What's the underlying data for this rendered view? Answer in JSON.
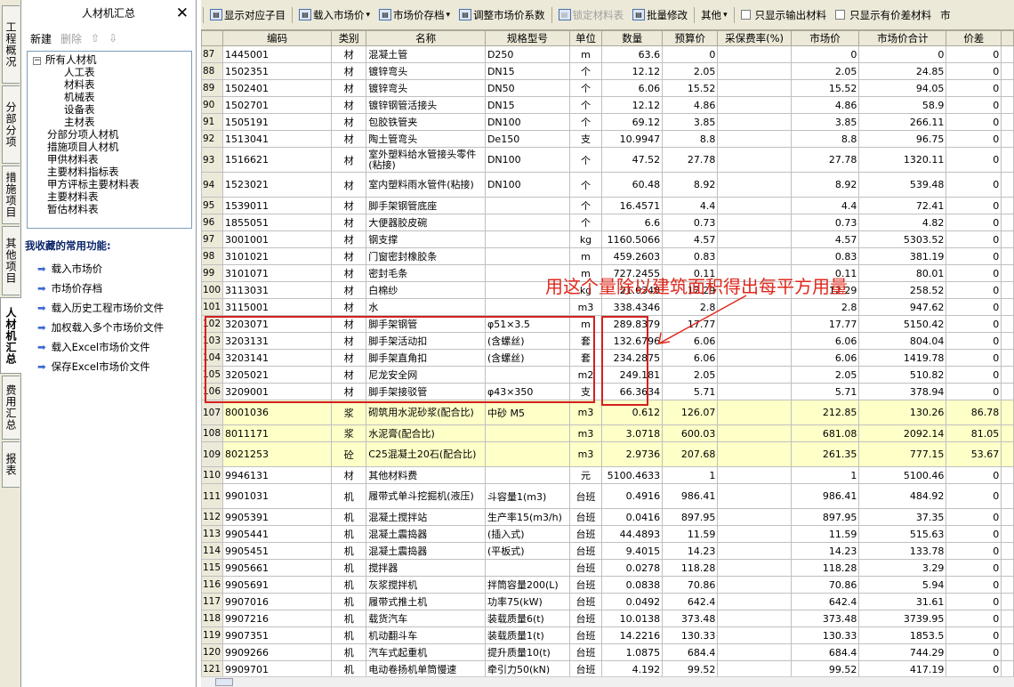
{
  "sidetabs": [
    {
      "label": "工程概况",
      "active": false
    },
    {
      "label": "分部分项",
      "active": false
    },
    {
      "label": "措施项目",
      "active": false
    },
    {
      "label": "其他项目",
      "active": false
    },
    {
      "label": "人材机汇总",
      "active": true
    },
    {
      "label": "费用汇总",
      "active": false
    },
    {
      "label": "报表",
      "active": false
    }
  ],
  "left": {
    "title": "人材机汇总",
    "close": "✕",
    "new": "新建",
    "delete": "删除",
    "tree": {
      "root": "所有人材机",
      "children": [
        "人工表",
        "材料表",
        "机械表",
        "设备表",
        "主材表"
      ],
      "others": [
        "分部分项人材机",
        "措施项目人材机",
        "甲供材料表",
        "主要材料指标表",
        "甲方评标主要材料表",
        "主要材料表",
        "暂估材料表"
      ]
    },
    "fav_title": "我收藏的常用功能:",
    "favs": [
      "载入市场价",
      "市场价存档",
      "载入历史工程市场价文件",
      "加权载入多个市场价文件",
      "载入Excel市场价文件",
      "保存Excel市场价文件"
    ]
  },
  "toolbar": [
    {
      "label": "显示对应子目",
      "icon": "list-icon",
      "disabled": false,
      "dropdown": false
    },
    {
      "label": "载入市场价",
      "icon": "load-price-icon",
      "disabled": false,
      "dropdown": true
    },
    {
      "label": "市场价存档",
      "icon": "archive-icon",
      "disabled": false,
      "dropdown": true
    },
    {
      "label": "调整市场价系数",
      "icon": "adjust-icon",
      "disabled": false,
      "dropdown": false
    },
    {
      "label": "锁定材料表",
      "icon": "lock-icon",
      "disabled": true,
      "dropdown": false
    },
    {
      "label": "批量修改",
      "icon": "batch-edit-icon",
      "disabled": false,
      "dropdown": false
    },
    {
      "label": "其他",
      "icon": "",
      "disabled": false,
      "dropdown": true
    },
    {
      "label": "只显示输出材料",
      "icon": "",
      "checkbox": true
    },
    {
      "label": "只显示有价差材料",
      "icon": "",
      "checkbox": true
    },
    {
      "label": "市",
      "icon": "",
      "disabled": false,
      "dropdown": false
    }
  ],
  "columns": [
    "",
    "编码",
    "类别",
    "名称",
    "规格型号",
    "单位",
    "数量",
    "预算价",
    "采保费率(%)",
    "市场价",
    "市场价合计",
    "价差",
    ""
  ],
  "rows": [
    {
      "no": "87",
      "code": "1445001",
      "cat": "材",
      "name": "混凝土管",
      "spec": "D250",
      "unit": "m",
      "qty": "63.6",
      "budget": "0",
      "rate": "",
      "market": "0",
      "total": "0",
      "diff": "0"
    },
    {
      "no": "88",
      "code": "1502351",
      "cat": "材",
      "name": "镀锌弯头",
      "spec": "DN15",
      "unit": "个",
      "qty": "12.12",
      "budget": "2.05",
      "rate": "",
      "market": "2.05",
      "total": "24.85",
      "diff": "0"
    },
    {
      "no": "89",
      "code": "1502401",
      "cat": "材",
      "name": "镀锌弯头",
      "spec": "DN50",
      "unit": "个",
      "qty": "6.06",
      "budget": "15.52",
      "rate": "",
      "market": "15.52",
      "total": "94.05",
      "diff": "0"
    },
    {
      "no": "90",
      "code": "1502701",
      "cat": "材",
      "name": "镀锌钢管活接头",
      "spec": "DN15",
      "unit": "个",
      "qty": "12.12",
      "budget": "4.86",
      "rate": "",
      "market": "4.86",
      "total": "58.9",
      "diff": "0"
    },
    {
      "no": "91",
      "code": "1505191",
      "cat": "材",
      "name": "包胶铁管夹",
      "spec": "DN100",
      "unit": "个",
      "qty": "69.12",
      "budget": "3.85",
      "rate": "",
      "market": "3.85",
      "total": "266.11",
      "diff": "0"
    },
    {
      "no": "92",
      "code": "1513041",
      "cat": "材",
      "name": "陶土管弯头",
      "spec": "De150",
      "unit": "支",
      "qty": "10.9947",
      "budget": "8.8",
      "rate": "",
      "market": "8.8",
      "total": "96.75",
      "diff": "0"
    },
    {
      "no": "93",
      "code": "1516621",
      "cat": "材",
      "name": "室外塑料给水管接头零件(粘接)",
      "spec": "DN100",
      "unit": "个",
      "qty": "47.52",
      "budget": "27.78",
      "rate": "",
      "market": "27.78",
      "total": "1320.11",
      "diff": "0",
      "tall": true
    },
    {
      "no": "94",
      "code": "1523021",
      "cat": "材",
      "name": "室内塑料雨水管件(粘接)",
      "spec": "DN100",
      "unit": "个",
      "qty": "60.48",
      "budget": "8.92",
      "rate": "",
      "market": "8.92",
      "total": "539.48",
      "diff": "0",
      "tall": true
    },
    {
      "no": "95",
      "code": "1539011",
      "cat": "材",
      "name": "脚手架钢管底座",
      "spec": "",
      "unit": "个",
      "qty": "16.4571",
      "budget": "4.4",
      "rate": "",
      "market": "4.4",
      "total": "72.41",
      "diff": "0"
    },
    {
      "no": "96",
      "code": "1855051",
      "cat": "材",
      "name": "大便器胶皮碗",
      "spec": "",
      "unit": "个",
      "qty": "6.6",
      "budget": "0.73",
      "rate": "",
      "market": "0.73",
      "total": "4.82",
      "diff": "0"
    },
    {
      "no": "97",
      "code": "3001001",
      "cat": "材",
      "name": "钢支撑",
      "spec": "",
      "unit": "kg",
      "qty": "1160.5066",
      "budget": "4.57",
      "rate": "",
      "market": "4.57",
      "total": "5303.52",
      "diff": "0"
    },
    {
      "no": "98",
      "code": "3101021",
      "cat": "材",
      "name": "门窗密封橡胶条",
      "spec": "",
      "unit": "m",
      "qty": "459.2603",
      "budget": "0.83",
      "rate": "",
      "market": "0.83",
      "total": "381.19",
      "diff": "0"
    },
    {
      "no": "99",
      "code": "3101071",
      "cat": "材",
      "name": "密封毛条",
      "spec": "",
      "unit": "m",
      "qty": "727.2455",
      "budget": "0.11",
      "rate": "",
      "market": "0.11",
      "total": "80.01",
      "diff": "0"
    },
    {
      "no": "100",
      "code": "3113031",
      "cat": "材",
      "name": "白棉纱",
      "spec": "",
      "unit": "kg",
      "qty": "21.0348",
      "budget": "12.29",
      "rate": "",
      "market": "12.29",
      "total": "258.52",
      "diff": "0"
    },
    {
      "no": "101",
      "code": "3115001",
      "cat": "材",
      "name": "水",
      "spec": "",
      "unit": "m3",
      "qty": "338.4346",
      "budget": "2.8",
      "rate": "",
      "market": "2.8",
      "total": "947.62",
      "diff": "0"
    },
    {
      "no": "102",
      "code": "3203071",
      "cat": "材",
      "name": "脚手架钢管",
      "spec": "φ51×3.5",
      "unit": "m",
      "qty": "289.8379",
      "budget": "17.77",
      "rate": "",
      "market": "17.77",
      "total": "5150.42",
      "diff": "0"
    },
    {
      "no": "103",
      "code": "3203131",
      "cat": "材",
      "name": "脚手架活动扣",
      "spec": "(含螺丝)",
      "unit": "套",
      "qty": "132.6796",
      "budget": "6.06",
      "rate": "",
      "market": "6.06",
      "total": "804.04",
      "diff": "0"
    },
    {
      "no": "104",
      "code": "3203141",
      "cat": "材",
      "name": "脚手架直角扣",
      "spec": "(含螺丝)",
      "unit": "套",
      "qty": "234.2875",
      "budget": "6.06",
      "rate": "",
      "market": "6.06",
      "total": "1419.78",
      "diff": "0"
    },
    {
      "no": "105",
      "code": "3205021",
      "cat": "材",
      "name": "尼龙安全网",
      "spec": "",
      "unit": "m2",
      "qty": "249.181",
      "budget": "2.05",
      "rate": "",
      "market": "2.05",
      "total": "510.82",
      "diff": "0"
    },
    {
      "no": "106",
      "code": "3209001",
      "cat": "材",
      "name": "脚手架接驳管",
      "spec": "φ43×350",
      "unit": "支",
      "qty": "66.3634",
      "budget": "5.71",
      "rate": "",
      "market": "5.71",
      "total": "378.94",
      "diff": "0"
    },
    {
      "no": "107",
      "code": "8001036",
      "cat": "浆",
      "name": "砌筑用水泥砂浆(配合比)",
      "spec": "中砂 M5",
      "unit": "m3",
      "qty": "0.612",
      "budget": "126.07",
      "rate": "",
      "market": "212.85",
      "total": "130.26",
      "diff": "86.78",
      "tall": true,
      "hl": true
    },
    {
      "no": "108",
      "code": "8011171",
      "cat": "浆",
      "name": "水泥膏(配合比)",
      "spec": "",
      "unit": "m3",
      "qty": "3.0718",
      "budget": "600.03",
      "rate": "",
      "market": "681.08",
      "total": "2092.14",
      "diff": "81.05",
      "hl": true
    },
    {
      "no": "109",
      "code": "8021253",
      "cat": "砼",
      "name": "C25混凝土20石(配合比)",
      "spec": "",
      "unit": "m3",
      "qty": "2.9736",
      "budget": "207.68",
      "rate": "",
      "market": "261.35",
      "total": "777.15",
      "diff": "53.67",
      "tall": true,
      "hl": true
    },
    {
      "no": "110",
      "code": "9946131",
      "cat": "材",
      "name": "其他材料费",
      "spec": "",
      "unit": "元",
      "qty": "5100.4633",
      "budget": "1",
      "rate": "",
      "market": "1",
      "total": "5100.46",
      "diff": "0"
    },
    {
      "no": "111",
      "code": "9901031",
      "cat": "机",
      "name": "履带式单斗挖掘机(液压)",
      "spec": "斗容量1(m3)",
      "unit": "台班",
      "qty": "0.4916",
      "budget": "986.41",
      "rate": "",
      "market": "986.41",
      "total": "484.92",
      "diff": "0",
      "tall": true
    },
    {
      "no": "112",
      "code": "9905391",
      "cat": "机",
      "name": "混凝土搅拌站",
      "spec": "生产率15(m3/h)",
      "unit": "台班",
      "qty": "0.0416",
      "budget": "897.95",
      "rate": "",
      "market": "897.95",
      "total": "37.35",
      "diff": "0"
    },
    {
      "no": "113",
      "code": "9905441",
      "cat": "机",
      "name": "混凝土震捣器",
      "spec": "(插入式)",
      "unit": "台班",
      "qty": "44.4893",
      "budget": "11.59",
      "rate": "",
      "market": "11.59",
      "total": "515.63",
      "diff": "0"
    },
    {
      "no": "114",
      "code": "9905451",
      "cat": "机",
      "name": "混凝土震捣器",
      "spec": "(平板式)",
      "unit": "台班",
      "qty": "9.4015",
      "budget": "14.23",
      "rate": "",
      "market": "14.23",
      "total": "133.78",
      "diff": "0"
    },
    {
      "no": "115",
      "code": "9905661",
      "cat": "机",
      "name": "搅拌器",
      "spec": "",
      "unit": "台班",
      "qty": "0.0278",
      "budget": "118.28",
      "rate": "",
      "market": "118.28",
      "total": "3.29",
      "diff": "0"
    },
    {
      "no": "116",
      "code": "9905691",
      "cat": "机",
      "name": "灰浆搅拌机",
      "spec": "拌筒容量200(L)",
      "unit": "台班",
      "qty": "0.0838",
      "budget": "70.86",
      "rate": "",
      "market": "70.86",
      "total": "5.94",
      "diff": "0"
    },
    {
      "no": "117",
      "code": "9907016",
      "cat": "机",
      "name": "履带式推土机",
      "spec": "功率75(kW)",
      "unit": "台班",
      "qty": "0.0492",
      "budget": "642.4",
      "rate": "",
      "market": "642.4",
      "total": "31.61",
      "diff": "0"
    },
    {
      "no": "118",
      "code": "9907216",
      "cat": "机",
      "name": "载货汽车",
      "spec": "装载质量6(t)",
      "unit": "台班",
      "qty": "10.0138",
      "budget": "373.48",
      "rate": "",
      "market": "373.48",
      "total": "3739.95",
      "diff": "0"
    },
    {
      "no": "119",
      "code": "9907351",
      "cat": "机",
      "name": "机动翻斗车",
      "spec": "装载质量1(t)",
      "unit": "台班",
      "qty": "14.2216",
      "budget": "130.33",
      "rate": "",
      "market": "130.33",
      "total": "1853.5",
      "diff": "0"
    },
    {
      "no": "120",
      "code": "9909266",
      "cat": "机",
      "name": "汽车式起重机",
      "spec": "提升质量10(t)",
      "unit": "台班",
      "qty": "1.0875",
      "budget": "684.4",
      "rate": "",
      "market": "684.4",
      "total": "744.29",
      "diff": "0"
    },
    {
      "no": "121",
      "code": "9909701",
      "cat": "机",
      "name": "电动卷扬机单筒慢速",
      "spec": "牵引力50(kN)",
      "unit": "台班",
      "qty": "4.192",
      "budget": "99.52",
      "rate": "",
      "market": "99.52",
      "total": "417.19",
      "diff": "0"
    }
  ],
  "annotation": "用这个量除以建筑面积得出每平方用量",
  "colors": {
    "annotation": "#e0281c",
    "highlight_row": "#ffffc8",
    "header_bg": "#ece9d8"
  }
}
